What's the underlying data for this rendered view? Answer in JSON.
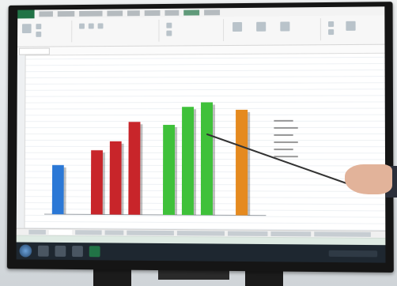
{
  "scene": {
    "description_colors": {
      "bezel": "#151515",
      "spreadsheet_accent": "#217346",
      "bar_blue": "#2b78d6",
      "bar_red": "#c8252a",
      "bar_green": "#3fc13a",
      "bar_orange": "#e58a1f",
      "pointer": "#333333"
    }
  },
  "chart_data": {
    "type": "bar",
    "categories": [
      "",
      "",
      "",
      "",
      "",
      "",
      "",
      "",
      ""
    ],
    "values": [
      33,
      43,
      49,
      62,
      60,
      72,
      75,
      78,
      70
    ],
    "series": [
      {
        "values": [
          33
        ]
      },
      {
        "values": [
          43,
          49,
          62
        ]
      },
      {
        "values": [
          60,
          72,
          75
        ]
      },
      {
        "values": [
          70
        ]
      }
    ],
    "ylim": [
      0,
      100
    ],
    "title": "",
    "xlabel": "",
    "ylabel": ""
  }
}
